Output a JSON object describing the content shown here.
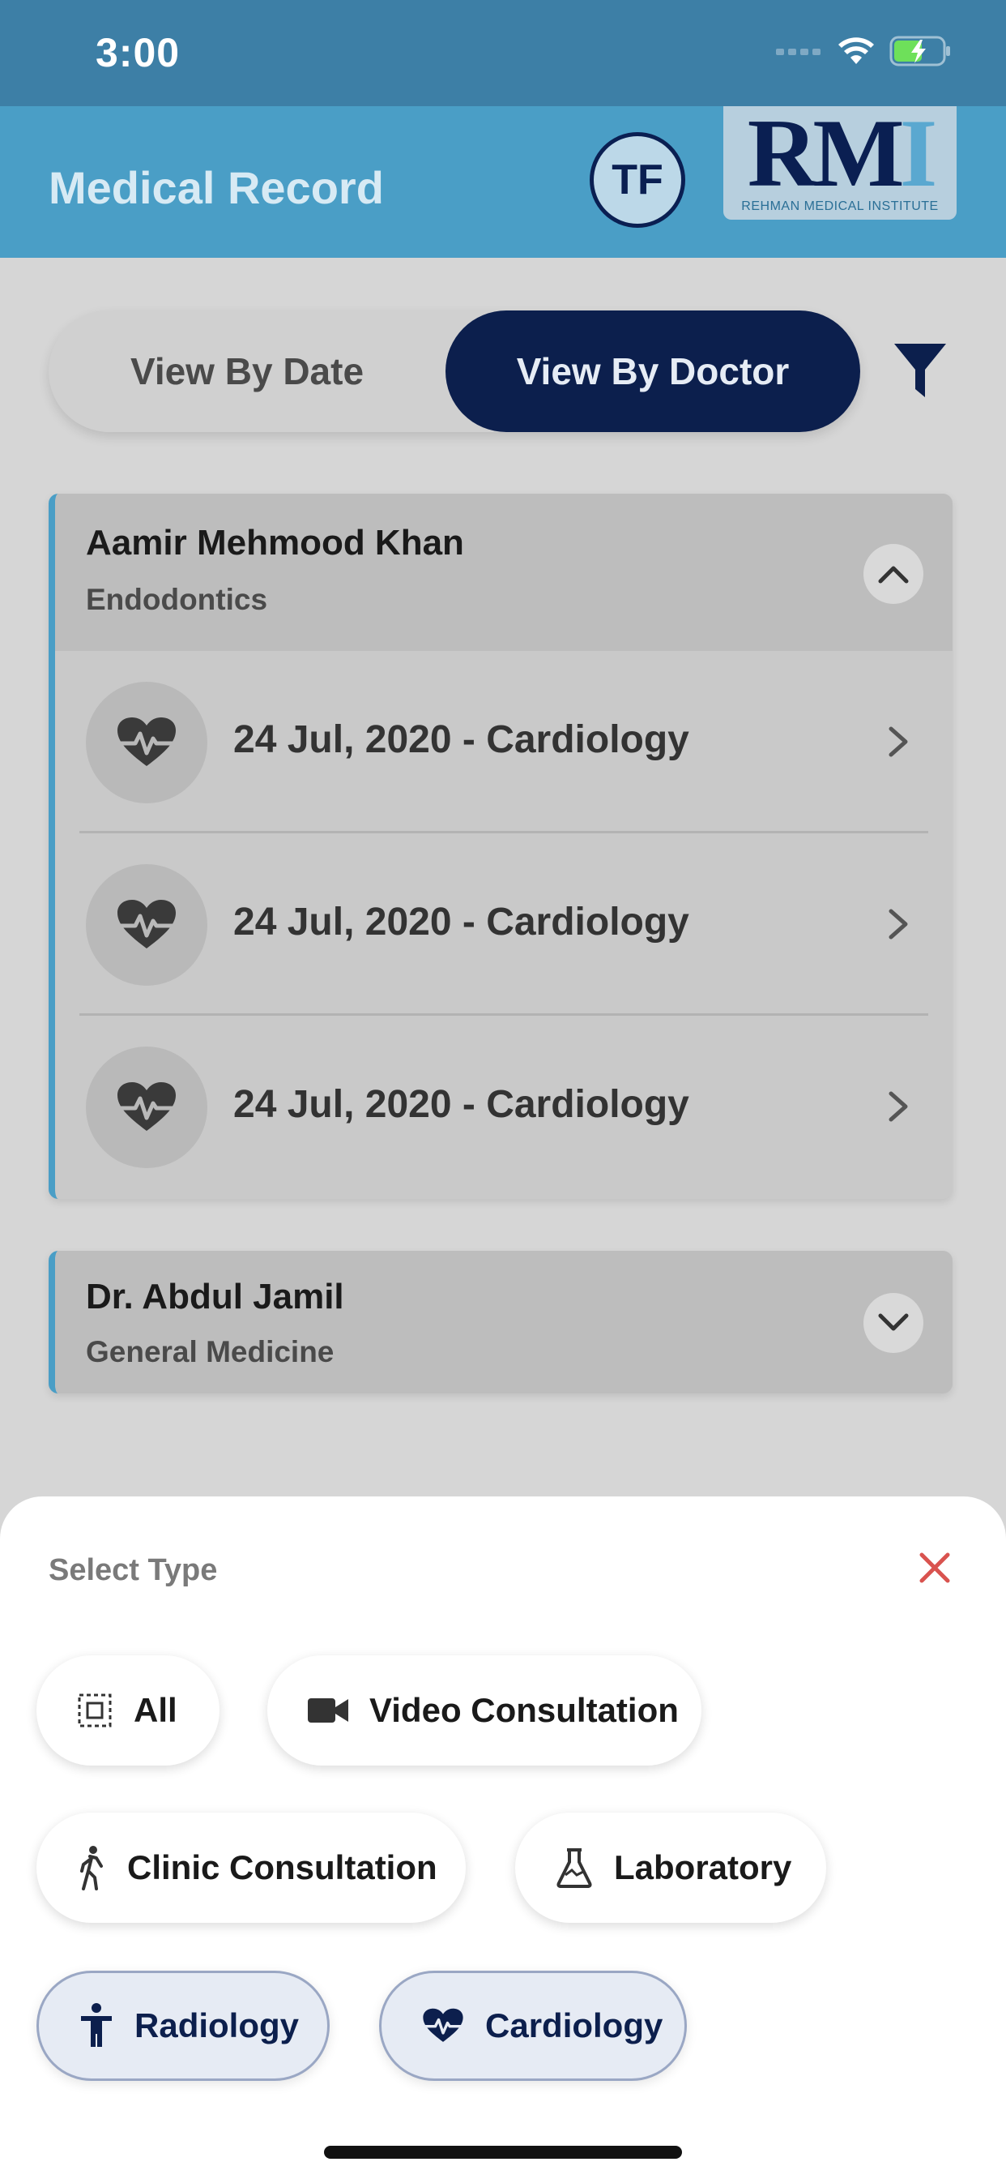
{
  "status_bar": {
    "time": "3:00"
  },
  "header": {
    "title": "Medical Record",
    "avatar_initials": "TF",
    "logo_text": "RMI",
    "logo_sub": "REHMAN MEDICAL INSTITUTE"
  },
  "view_toggle": {
    "by_date": "View By Date",
    "by_doctor": "View By Doctor",
    "selected": "View By Doctor"
  },
  "doctors": [
    {
      "name": "Aamir Mehmood Khan",
      "specialty": "Endodontics",
      "expanded": true,
      "records": [
        {
          "label": "24 Jul, 2020 - Cardiology"
        },
        {
          "label": "24 Jul, 2020 - Cardiology"
        },
        {
          "label": "24 Jul, 2020 - Cardiology"
        }
      ]
    },
    {
      "name": "Dr. Abdul  Jamil",
      "specialty": "General Medicine",
      "expanded": false
    }
  ],
  "sheet": {
    "title": "Select Type",
    "chips": [
      {
        "label": "All",
        "icon": "select-all-icon",
        "selected": false
      },
      {
        "label": "Video Consultation",
        "icon": "videocam-icon",
        "selected": false
      },
      {
        "label": "Clinic Consultation",
        "icon": "walking-person-icon",
        "selected": false
      },
      {
        "label": "Laboratory",
        "icon": "flask-icon",
        "selected": false
      },
      {
        "label": "Radiology",
        "icon": "person-accessibility-icon",
        "selected": true
      },
      {
        "label": "Cardiology",
        "icon": "heart-pulse-icon",
        "selected": true
      }
    ]
  },
  "colors": {
    "primary_navy": "#0c1f4d",
    "header_blue": "#4a9ec6",
    "close_red": "#d9534f"
  }
}
